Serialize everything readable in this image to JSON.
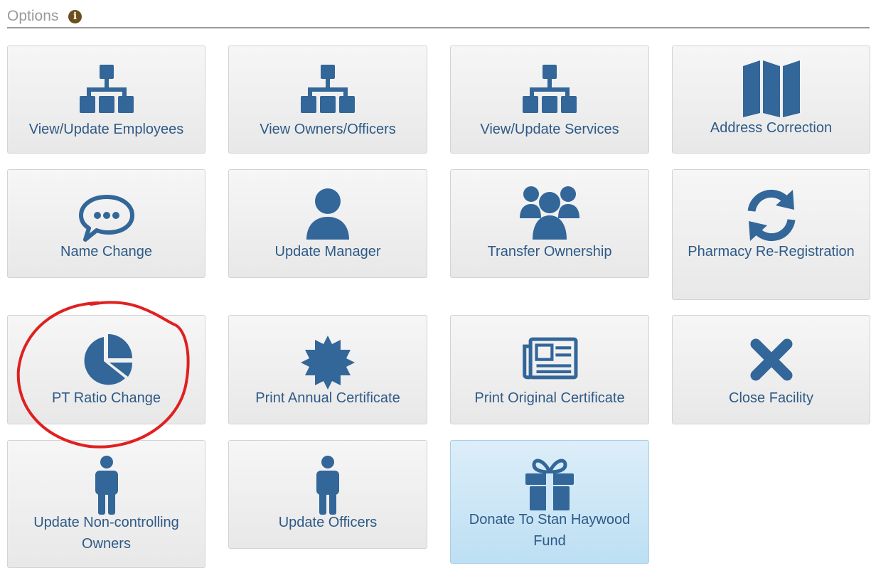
{
  "header": {
    "title": "Options",
    "info_icon": "info-circle-icon"
  },
  "colors": {
    "icon": "#336699",
    "label": "#2e5a86",
    "tile_bg": "#eeeeee",
    "tile_primary_bg": "#cfe8f7",
    "annotation": "#e02020"
  },
  "tiles": [
    {
      "label": "View/Update Employees",
      "icon": "sitemap-icon"
    },
    {
      "label": "View Owners/Officers",
      "icon": "sitemap-icon"
    },
    {
      "label": "View/Update Services",
      "icon": "sitemap-icon"
    },
    {
      "label": "Address Correction",
      "icon": "map-icon"
    },
    {
      "label": "Name Change",
      "icon": "speech-bubble-icon"
    },
    {
      "label": "Update Manager",
      "icon": "user-icon"
    },
    {
      "label": "Transfer Ownership",
      "icon": "users-icon"
    },
    {
      "label": "Pharmacy Re-Registration",
      "icon": "refresh-icon"
    },
    {
      "label": "PT Ratio Change",
      "icon": "pie-chart-icon"
    },
    {
      "label": "Print Annual Certificate",
      "icon": "certificate-icon"
    },
    {
      "label": "Print Original Certificate",
      "icon": "newspaper-icon"
    },
    {
      "label": "Close Facility",
      "icon": "close-icon"
    },
    {
      "label": "Update Non-controlling Owners",
      "icon": "male-icon"
    },
    {
      "label": "Update Officers",
      "icon": "male-icon"
    },
    {
      "label": "Donate To Stan Haywood Fund",
      "icon": "gift-icon"
    }
  ]
}
